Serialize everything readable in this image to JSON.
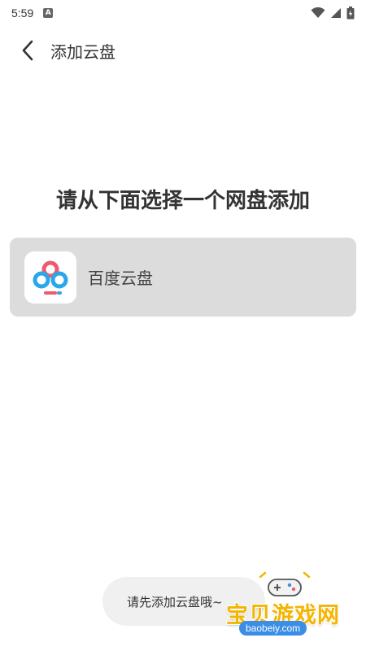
{
  "status_bar": {
    "time": "5:59",
    "notif_icon": "A"
  },
  "header": {
    "title": "添加云盘"
  },
  "main": {
    "heading": "请从下面选择一个网盘添加",
    "providers": [
      {
        "name": "百度云盘",
        "icon": "baidu-cloud-logo"
      }
    ]
  },
  "toast": {
    "text": "请先添加云盘哦~"
  },
  "watermark": {
    "brand": "宝贝游戏网",
    "url": "baobeiy.com"
  },
  "colors": {
    "card_bg": "#dcdcdc",
    "toast_bg": "#f0f0f0",
    "watermark_yellow": "#f5b400",
    "watermark_blue": "#3a8ee6"
  }
}
